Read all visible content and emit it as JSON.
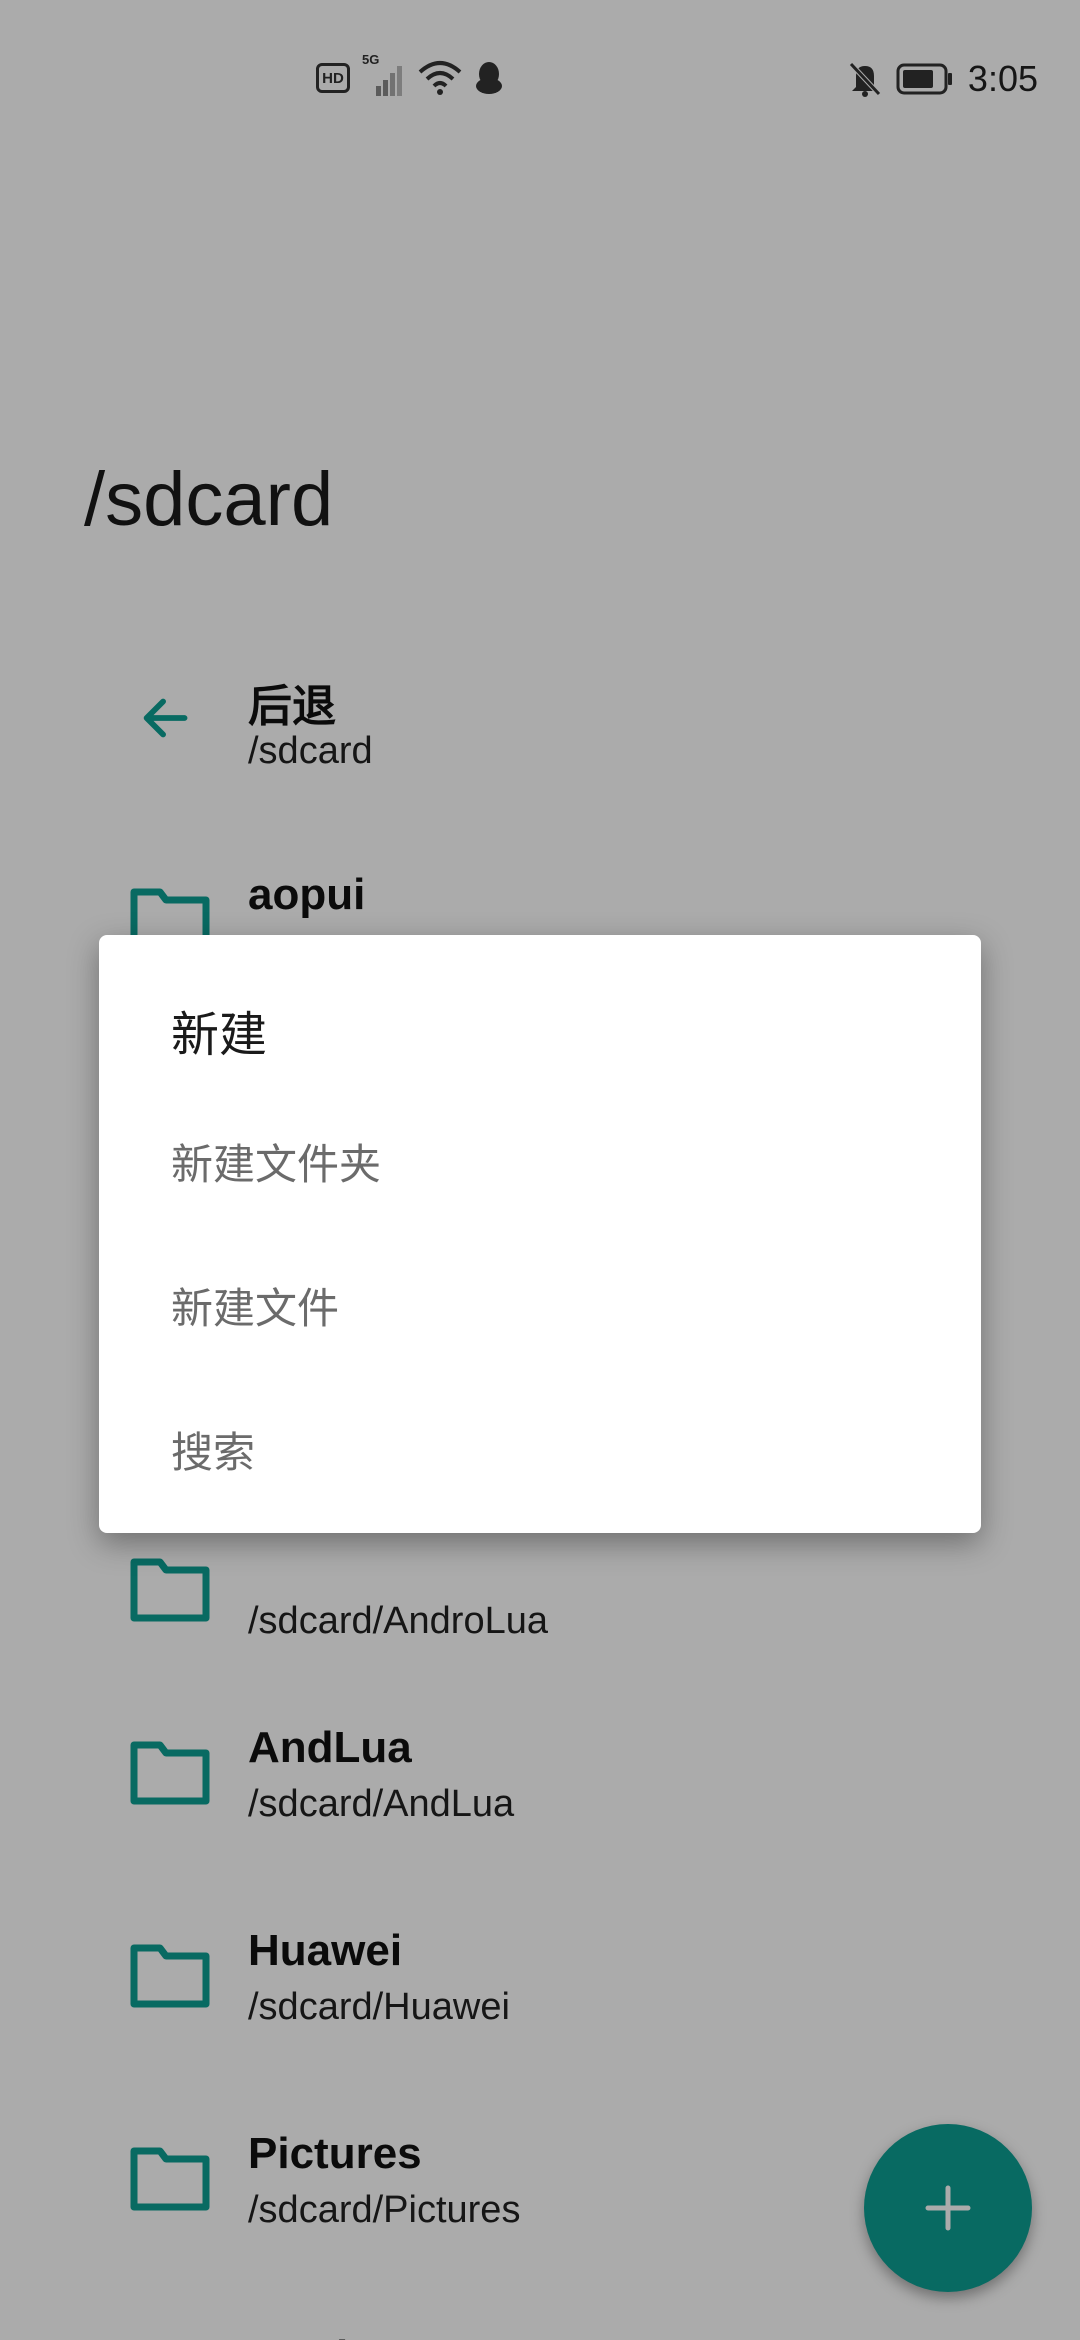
{
  "status_bar": {
    "hd_label": "HD",
    "network_label": "5G",
    "time": "3:05"
  },
  "header": {
    "path": "/sdcard"
  },
  "back_item": {
    "label": "后退",
    "path": "/sdcard"
  },
  "folders": [
    {
      "name": "aopui",
      "path": ""
    },
    {
      "name": "",
      "path": "/sdcard/AndroLua"
    },
    {
      "name": "AndLua",
      "path": "/sdcard/AndLua"
    },
    {
      "name": "Huawei",
      "path": "/sdcard/Huawei"
    },
    {
      "name": "Pictures",
      "path": "/sdcard/Pictures"
    },
    {
      "name": "Movies",
      "path": ""
    }
  ],
  "dialog": {
    "title": "新建",
    "items": [
      {
        "label": "新建文件夹"
      },
      {
        "label": "新建文件"
      },
      {
        "label": "搜索"
      }
    ]
  },
  "colors": {
    "accent": "#0d9f92",
    "scrim": "rgba(0,0,0,0.33)"
  },
  "icons": {
    "back": "arrow-left-icon",
    "folder": "folder-icon",
    "fab": "plus-icon"
  }
}
